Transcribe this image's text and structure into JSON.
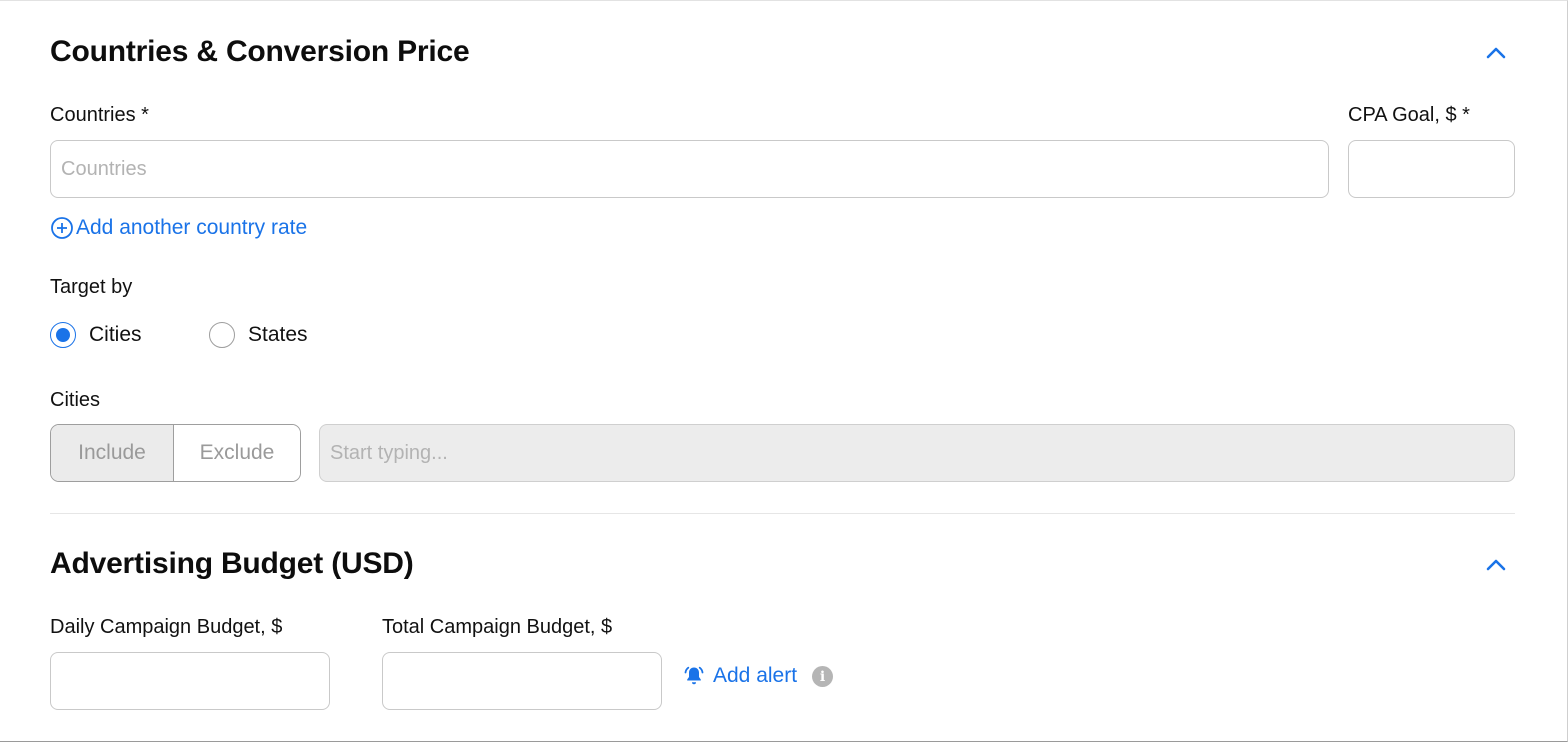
{
  "countries_section": {
    "title": "Countries & Conversion Price",
    "collapse_icon": "chevron-up-icon",
    "countries_label": "Countries *",
    "countries_placeholder": "Countries",
    "countries_value": "",
    "cpa_label": "CPA Goal, $ *",
    "cpa_value": "",
    "add_country_rate_icon": "plus-circle-icon",
    "add_country_rate_label": "Add another country rate",
    "target_by_label": "Target by",
    "target_options": [
      {
        "label": "Cities",
        "checked": true
      },
      {
        "label": "States",
        "checked": false
      }
    ],
    "cities_label": "Cities",
    "include_label": "Include",
    "exclude_label": "Exclude",
    "cities_placeholder": "Start typing..."
  },
  "budget_section": {
    "title": "Advertising Budget (USD)",
    "collapse_icon": "chevron-up-icon",
    "daily_label": "Daily Campaign Budget, $",
    "daily_value": "",
    "total_label": "Total Campaign Budget, $",
    "total_value": "",
    "add_alert_icon": "bell-icon",
    "add_alert_label": "Add alert",
    "info_icon": "info-icon"
  },
  "colors": {
    "accent": "#1a73e8",
    "disabled_bg": "#ececec",
    "border": "#c9c9c9"
  }
}
